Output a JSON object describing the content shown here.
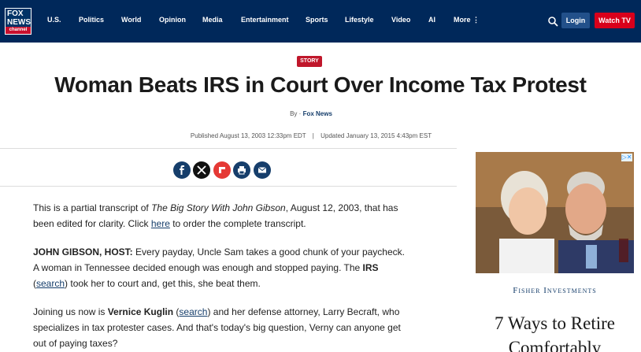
{
  "nav": {
    "logo_top": "FOX NEWS",
    "logo_bottom": "channel",
    "links": [
      "U.S.",
      "Politics",
      "World",
      "Opinion",
      "Media",
      "Entertainment",
      "Sports",
      "Lifestyle",
      "Video",
      "AI",
      "More"
    ],
    "login": "Login",
    "watch": "Watch TV"
  },
  "article": {
    "badge": "STORY",
    "headline": "Woman Beats IRS in Court Over Income Tax Protest",
    "by": "By",
    "author": "Fox News",
    "published": "Published August 13, 2003 12:33pm EDT",
    "sep": "|",
    "updated": "Updated January 13, 2015 4:43pm EST"
  },
  "body": {
    "p1_a": "This is a partial transcript of ",
    "p1_title": "The Big Story With John Gibson",
    "p1_b": ", August 12, 2003, that has been edited for clarity. Click ",
    "p1_link": "here",
    "p1_c": " to order the complete transcript.",
    "p2_speaker": "JOHN GIBSON, HOST:",
    "p2_a": " Every payday, Uncle Sam takes a good chunk of your paycheck. A woman in Tennessee decided enough was enough and stopped paying. The ",
    "p2_irs": "IRS",
    "p2_b": " (",
    "p2_link": "search",
    "p2_c": ") took her to court and, get this, she beat them.",
    "p3_a": "Joining us now is ",
    "p3_name": "Vernice Kuglin",
    "p3_b": " (",
    "p3_link": "search",
    "p3_c": ") and her defense attorney, Larry Becraft, who specializes in tax protester cases. And that's today's big question, Verny can anyone get out of paying taxes?"
  },
  "ad": {
    "choices": "▷✕",
    "brand": "Fisher Investments",
    "title": "7 Ways to Retire",
    "title2": "Comfortably"
  },
  "colors": {
    "nav": "#00285a",
    "accent": "#c0172b",
    "link": "#163e6b"
  }
}
